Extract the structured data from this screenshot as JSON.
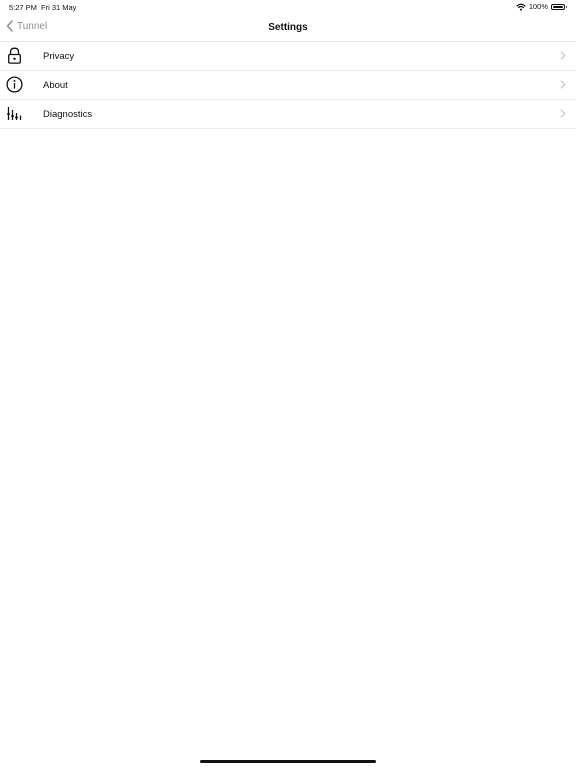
{
  "status_bar": {
    "time": "5:27 PM",
    "date": "Fri 31 May",
    "battery": "100%",
    "wifi_icon": "wifi-icon",
    "battery_icon": "battery-icon"
  },
  "nav": {
    "back_label": "Tunnel",
    "back_icon": "chevron-left-icon",
    "title": "Settings"
  },
  "settings": {
    "items": [
      {
        "label": "Privacy",
        "icon": "lock-icon"
      },
      {
        "label": "About",
        "icon": "info-icon"
      },
      {
        "label": "Diagnostics",
        "icon": "sliders-icon"
      }
    ],
    "chevron_icon": "chevron-right-icon"
  },
  "colors": {
    "background": "#ffffff",
    "text": "#111111",
    "secondary_text": "#8e8e93",
    "separator": "#ececec",
    "chevron": "#c4c4c7"
  }
}
